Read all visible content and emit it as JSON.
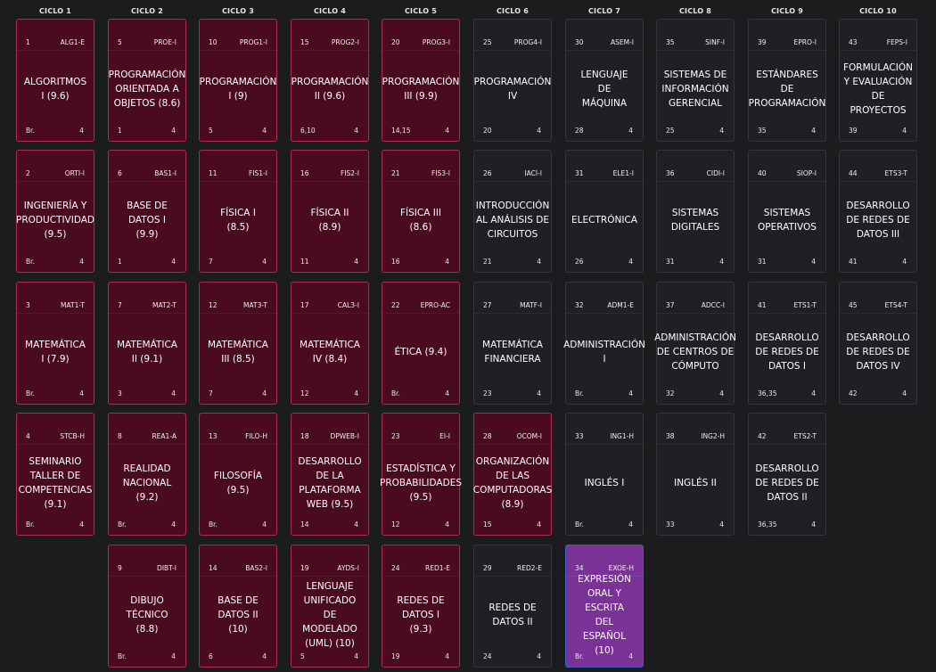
{
  "colors": {
    "background": "#1b1c1e",
    "approved": "#4a0a20",
    "approved_border": "#b02a52",
    "current": "#7b3296",
    "current_border": "#3a63c9",
    "pending": "#1f2023",
    "pending_border": "#34363a"
  },
  "cycles": [
    "CICLO 1",
    "CICLO 2",
    "CICLO 3",
    "CICLO 4",
    "CICLO 5",
    "CICLO 6",
    "CICLO 7",
    "CICLO 8",
    "CICLO 9",
    "CICLO 10"
  ],
  "courses": [
    {
      "cycle": 1,
      "row": 1,
      "num": "1",
      "code": "ALG1-E",
      "name": [
        "ALGORITMOS",
        "I (9.6)"
      ],
      "req": "Br.",
      "uv": "4",
      "status": "approved"
    },
    {
      "cycle": 1,
      "row": 2,
      "num": "2",
      "code": "ORTI-I",
      "name": [
        "INGENIERÍA Y",
        "PRODUCTIVIDAD",
        "(9.5)"
      ],
      "req": "Br.",
      "uv": "4",
      "status": "approved"
    },
    {
      "cycle": 1,
      "row": 3,
      "num": "3",
      "code": "MAT1-T",
      "name": [
        "MATEMÁTICA",
        "I (7.9)"
      ],
      "req": "Br.",
      "uv": "4",
      "status": "approved"
    },
    {
      "cycle": 1,
      "row": 4,
      "num": "4",
      "code": "STCB-H",
      "name": [
        "SEMINARIO",
        "TALLER DE",
        "COMPETENCIAS",
        "(9.1)"
      ],
      "req": "Br.",
      "uv": "4",
      "status": "approved"
    },
    {
      "cycle": 2,
      "row": 1,
      "num": "5",
      "code": "PROE-I",
      "name": [
        "PROGRAMACIÓN",
        "ORIENTADA A",
        "OBJETOS (8.6)"
      ],
      "req": "1",
      "uv": "4",
      "status": "approved"
    },
    {
      "cycle": 2,
      "row": 2,
      "num": "6",
      "code": "BAS1-I",
      "name": [
        "BASE DE",
        "DATOS I",
        "(9.9)"
      ],
      "req": "1",
      "uv": "4",
      "status": "approved"
    },
    {
      "cycle": 2,
      "row": 3,
      "num": "7",
      "code": "MAT2-T",
      "name": [
        "MATEMÁTICA",
        "II (9.1)"
      ],
      "req": "3",
      "uv": "4",
      "status": "approved"
    },
    {
      "cycle": 2,
      "row": 4,
      "num": "8",
      "code": "REA1-A",
      "name": [
        "REALIDAD",
        "NACIONAL",
        "(9.2)"
      ],
      "req": "Br.",
      "uv": "4",
      "status": "approved"
    },
    {
      "cycle": 2,
      "row": 5,
      "num": "9",
      "code": "DIBT-I",
      "name": [
        "DIBUJO",
        "TÉCNICO",
        "(8.8)"
      ],
      "req": "Br.",
      "uv": "4",
      "status": "approved"
    },
    {
      "cycle": 3,
      "row": 1,
      "num": "10",
      "code": "PROG1-I",
      "name": [
        "PROGRAMACIÓN",
        "I (9)"
      ],
      "req": "5",
      "uv": "4",
      "status": "approved"
    },
    {
      "cycle": 3,
      "row": 2,
      "num": "11",
      "code": "FIS1-I",
      "name": [
        "FÍSICA I",
        "(8.5)"
      ],
      "req": "7",
      "uv": "4",
      "status": "approved"
    },
    {
      "cycle": 3,
      "row": 3,
      "num": "12",
      "code": "MAT3-T",
      "name": [
        "MATEMÁTICA",
        "III (8.5)"
      ],
      "req": "7",
      "uv": "4",
      "status": "approved"
    },
    {
      "cycle": 3,
      "row": 4,
      "num": "13",
      "code": "FILO-H",
      "name": [
        "FILOSOFÍA",
        "(9.5)"
      ],
      "req": "Br.",
      "uv": "4",
      "status": "approved"
    },
    {
      "cycle": 3,
      "row": 5,
      "num": "14",
      "code": "BAS2-I",
      "name": [
        "BASE DE",
        "DATOS II",
        "(10)"
      ],
      "req": "6",
      "uv": "4",
      "status": "approved"
    },
    {
      "cycle": 4,
      "row": 1,
      "num": "15",
      "code": "PROG2-I",
      "name": [
        "PROGRAMACIÓN",
        "II (9.6)"
      ],
      "req": "6,10",
      "uv": "4",
      "status": "approved"
    },
    {
      "cycle": 4,
      "row": 2,
      "num": "16",
      "code": "FIS2-I",
      "name": [
        "FÍSICA II",
        "(8.9)"
      ],
      "req": "11",
      "uv": "4",
      "status": "approved"
    },
    {
      "cycle": 4,
      "row": 3,
      "num": "17",
      "code": "CAL3-I",
      "name": [
        "MATEMÁTICA",
        "IV (8.4)"
      ],
      "req": "12",
      "uv": "4",
      "status": "approved"
    },
    {
      "cycle": 4,
      "row": 4,
      "num": "18",
      "code": "DPWEB-I",
      "name": [
        "DESARROLLO",
        "DE LA",
        "PLATAFORMA",
        "WEB (9.5)"
      ],
      "req": "14",
      "uv": "4",
      "status": "approved"
    },
    {
      "cycle": 4,
      "row": 5,
      "num": "19",
      "code": "AYDS-I",
      "name": [
        "LENGUAJE",
        "UNIFICADO",
        "DE",
        "MODELADO",
        "(UML) (10)"
      ],
      "req": "5",
      "uv": "4",
      "status": "approved"
    },
    {
      "cycle": 5,
      "row": 1,
      "num": "20",
      "code": "PROG3-I",
      "name": [
        "PROGRAMACIÓN",
        "III (9.9)"
      ],
      "req": "14,15",
      "uv": "4",
      "status": "approved"
    },
    {
      "cycle": 5,
      "row": 2,
      "num": "21",
      "code": "FIS3-I",
      "name": [
        "FÍSICA III",
        "(8.6)"
      ],
      "req": "16",
      "uv": "4",
      "status": "approved"
    },
    {
      "cycle": 5,
      "row": 3,
      "num": "22",
      "code": "EPRO-AC",
      "name": [
        "ÉTICA (9.4)"
      ],
      "req": "Br.",
      "uv": "4",
      "status": "approved"
    },
    {
      "cycle": 5,
      "row": 4,
      "num": "23",
      "code": "EI-I",
      "name": [
        "ESTADÍSTICA Y",
        "PROBABILIDADES",
        "(9.5)"
      ],
      "req": "12",
      "uv": "4",
      "status": "approved"
    },
    {
      "cycle": 5,
      "row": 5,
      "num": "24",
      "code": "RED1-E",
      "name": [
        "REDES DE",
        "DATOS I",
        "(9.3)"
      ],
      "req": "19",
      "uv": "4",
      "status": "approved"
    },
    {
      "cycle": 6,
      "row": 1,
      "num": "25",
      "code": "PROG4-I",
      "name": [
        "PROGRAMACIÓN",
        "IV"
      ],
      "req": "20",
      "uv": "4",
      "status": "pending"
    },
    {
      "cycle": 6,
      "row": 2,
      "num": "26",
      "code": "IACI-I",
      "name": [
        "INTRODUCCIÓN",
        "AL ANÁLISIS DE",
        "CIRCUITOS"
      ],
      "req": "21",
      "uv": "4",
      "status": "pending"
    },
    {
      "cycle": 6,
      "row": 3,
      "num": "27",
      "code": "MATF-I",
      "name": [
        "MATEMÁTICA",
        "FINANCIERA"
      ],
      "req": "23",
      "uv": "4",
      "status": "pending"
    },
    {
      "cycle": 6,
      "row": 4,
      "num": "28",
      "code": "OCOM-I",
      "name": [
        "ORGANIZACIÓN",
        "DE LAS",
        "COMPUTADORAS",
        "(8.9)"
      ],
      "req": "15",
      "uv": "4",
      "status": "approved"
    },
    {
      "cycle": 6,
      "row": 5,
      "num": "29",
      "code": "RED2-E",
      "name": [
        "REDES DE",
        "DATOS II"
      ],
      "req": "24",
      "uv": "4",
      "status": "pending"
    },
    {
      "cycle": 7,
      "row": 1,
      "num": "30",
      "code": "ASEM-I",
      "name": [
        "LENGUAJE",
        "DE",
        "MÁQUINA"
      ],
      "req": "28",
      "uv": "4",
      "status": "pending"
    },
    {
      "cycle": 7,
      "row": 2,
      "num": "31",
      "code": "ELE1-I",
      "name": [
        "ELECTRÓNICA"
      ],
      "req": "26",
      "uv": "4",
      "status": "pending"
    },
    {
      "cycle": 7,
      "row": 3,
      "num": "32",
      "code": "ADM1-E",
      "name": [
        "ADMINISTRACIÓN",
        "I"
      ],
      "req": "Br.",
      "uv": "4",
      "status": "pending"
    },
    {
      "cycle": 7,
      "row": 4,
      "num": "33",
      "code": "ING1-H",
      "name": [
        "INGLÉS I"
      ],
      "req": "Br.",
      "uv": "4",
      "status": "pending"
    },
    {
      "cycle": 7,
      "row": 5,
      "num": "34",
      "code": "EXOE-H",
      "name": [
        "EXPRESIÓN",
        "ORAL Y",
        "ESCRITA",
        "DEL",
        "ESPAÑOL",
        "(10)"
      ],
      "req": "Br.",
      "uv": "4",
      "status": "current"
    },
    {
      "cycle": 8,
      "row": 1,
      "num": "35",
      "code": "SINF-I",
      "name": [
        "SISTEMAS DE",
        "INFORMACIÓN",
        "GERENCIAL"
      ],
      "req": "25",
      "uv": "4",
      "status": "pending"
    },
    {
      "cycle": 8,
      "row": 2,
      "num": "36",
      "code": "CIDI-I",
      "name": [
        "SISTEMAS",
        "DIGITALES"
      ],
      "req": "31",
      "uv": "4",
      "status": "pending"
    },
    {
      "cycle": 8,
      "row": 3,
      "num": "37",
      "code": "ADCC-I",
      "name": [
        "ADMINISTRACIÓN",
        "DE CENTROS DE",
        "CÓMPUTO"
      ],
      "req": "32",
      "uv": "4",
      "status": "pending"
    },
    {
      "cycle": 8,
      "row": 4,
      "num": "38",
      "code": "ING2-H",
      "name": [
        "INGLÉS II"
      ],
      "req": "33",
      "uv": "4",
      "status": "pending"
    },
    {
      "cycle": 9,
      "row": 1,
      "num": "39",
      "code": "EPRO-I",
      "name": [
        "ESTÁNDARES DE",
        "PROGRAMACIÓN"
      ],
      "req": "35",
      "uv": "4",
      "status": "pending"
    },
    {
      "cycle": 9,
      "row": 2,
      "num": "40",
      "code": "SIOP-I",
      "name": [
        "SISTEMAS",
        "OPERATIVOS"
      ],
      "req": "31",
      "uv": "4",
      "status": "pending"
    },
    {
      "cycle": 9,
      "row": 3,
      "num": "41",
      "code": "ETS1-T",
      "name": [
        "DESARROLLO",
        "DE REDES DE",
        "DATOS I"
      ],
      "req": "36,35",
      "uv": "4",
      "status": "pending"
    },
    {
      "cycle": 9,
      "row": 4,
      "num": "42",
      "code": "ETS2-T",
      "name": [
        "DESARROLLO",
        "DE REDES DE",
        "DATOS II"
      ],
      "req": "36,35",
      "uv": "4",
      "status": "pending"
    },
    {
      "cycle": 10,
      "row": 1,
      "num": "43",
      "code": "FEPS-I",
      "name": [
        "FORMULACIÓN",
        "Y EVALUACIÓN",
        "DE",
        "PROYECTOS"
      ],
      "req": "39",
      "uv": "4",
      "status": "pending"
    },
    {
      "cycle": 10,
      "row": 2,
      "num": "44",
      "code": "ETS3-T",
      "name": [
        "DESARROLLO",
        "DE REDES DE",
        "DATOS III"
      ],
      "req": "41",
      "uv": "4",
      "status": "pending"
    },
    {
      "cycle": 10,
      "row": 3,
      "num": "45",
      "code": "ETS4-T",
      "name": [
        "DESARROLLO",
        "DE REDES DE",
        "DATOS IV"
      ],
      "req": "42",
      "uv": "4",
      "status": "pending"
    }
  ]
}
